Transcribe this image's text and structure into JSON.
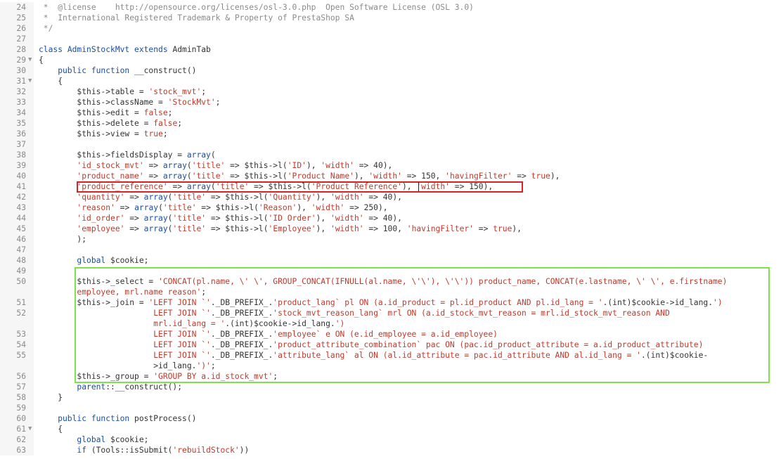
{
  "editor": {
    "lines": [
      {
        "n": "24",
        "fold": false,
        "tokens": [
          {
            "t": " *  @license    http://opensource.org/licenses/osl-3.0.php  Open Software License (OSL 3.0)",
            "k": "com"
          }
        ]
      },
      {
        "n": "25",
        "fold": false,
        "tokens": [
          {
            "t": " *  International Registered Trademark & Property of PrestaShop SA",
            "k": "com"
          }
        ]
      },
      {
        "n": "26",
        "fold": false,
        "tokens": [
          {
            "t": " */",
            "k": "com"
          }
        ]
      },
      {
        "n": "27",
        "fold": false,
        "tokens": []
      },
      {
        "n": "28",
        "fold": false,
        "tokens": [
          {
            "t": "class ",
            "k": "kw"
          },
          {
            "t": "AdminStockMvt ",
            "k": "kw"
          },
          {
            "t": "extends ",
            "k": "kw"
          },
          {
            "t": "AdminTab",
            "k": "def"
          }
        ]
      },
      {
        "n": "29",
        "fold": true,
        "tokens": [
          {
            "t": "{",
            "k": "def"
          }
        ]
      },
      {
        "n": "30",
        "fold": false,
        "tokens": [
          {
            "t": "    public function ",
            "k": "kw"
          },
          {
            "t": "__construct()",
            "k": "def"
          }
        ]
      },
      {
        "n": "31",
        "fold": true,
        "tokens": [
          {
            "t": "    {",
            "k": "def"
          }
        ]
      },
      {
        "n": "32",
        "fold": false,
        "tokens": [
          {
            "t": "        $this->table = ",
            "k": "def"
          },
          {
            "t": "'stock_mvt'",
            "k": "str"
          },
          {
            "t": ";",
            "k": "def"
          }
        ]
      },
      {
        "n": "33",
        "fold": false,
        "tokens": [
          {
            "t": "        $this->className = ",
            "k": "def"
          },
          {
            "t": "'StockMvt'",
            "k": "str"
          },
          {
            "t": ";",
            "k": "def"
          }
        ]
      },
      {
        "n": "34",
        "fold": false,
        "tokens": [
          {
            "t": "        $this->edit = ",
            "k": "def"
          },
          {
            "t": "false",
            "k": "str"
          },
          {
            "t": ";",
            "k": "def"
          }
        ]
      },
      {
        "n": "35",
        "fold": false,
        "tokens": [
          {
            "t": "        $this->delete = ",
            "k": "def"
          },
          {
            "t": "false",
            "k": "str"
          },
          {
            "t": ";",
            "k": "def"
          }
        ]
      },
      {
        "n": "36",
        "fold": false,
        "tokens": [
          {
            "t": "        $this->view = ",
            "k": "def"
          },
          {
            "t": "true",
            "k": "str"
          },
          {
            "t": ";",
            "k": "def"
          }
        ]
      },
      {
        "n": "37",
        "fold": false,
        "tokens": []
      },
      {
        "n": "38",
        "fold": false,
        "tokens": [
          {
            "t": "        $this->fieldsDisplay = ",
            "k": "def"
          },
          {
            "t": "array",
            "k": "kw"
          },
          {
            "t": "(",
            "k": "def"
          }
        ]
      },
      {
        "n": "39",
        "fold": false,
        "tokens": [
          {
            "t": "        ",
            "k": "def"
          },
          {
            "t": "'id_stock_mvt'",
            "k": "str"
          },
          {
            "t": " => ",
            "k": "def"
          },
          {
            "t": "array",
            "k": "kw"
          },
          {
            "t": "(",
            "k": "def"
          },
          {
            "t": "'title'",
            "k": "str"
          },
          {
            "t": " => $this->l(",
            "k": "def"
          },
          {
            "t": "'ID'",
            "k": "str"
          },
          {
            "t": "), ",
            "k": "def"
          },
          {
            "t": "'width'",
            "k": "str"
          },
          {
            "t": " => 40),",
            "k": "def"
          }
        ]
      },
      {
        "n": "40",
        "fold": false,
        "tokens": [
          {
            "t": "        ",
            "k": "def"
          },
          {
            "t": "'product_name'",
            "k": "str"
          },
          {
            "t": " => ",
            "k": "def"
          },
          {
            "t": "array",
            "k": "kw"
          },
          {
            "t": "(",
            "k": "def"
          },
          {
            "t": "'title'",
            "k": "str"
          },
          {
            "t": " => $this->l(",
            "k": "def"
          },
          {
            "t": "'Product Name'",
            "k": "str"
          },
          {
            "t": "), ",
            "k": "def"
          },
          {
            "t": "'width'",
            "k": "str"
          },
          {
            "t": " => 150, ",
            "k": "def"
          },
          {
            "t": "'havingFilter'",
            "k": "str"
          },
          {
            "t": " => ",
            "k": "def"
          },
          {
            "t": "true",
            "k": "str"
          },
          {
            "t": "),",
            "k": "def"
          }
        ]
      },
      {
        "n": "41",
        "fold": false,
        "tokens": [
          {
            "t": "        ",
            "k": "def"
          },
          {
            "t": "'product_reference'",
            "k": "str"
          },
          {
            "t": " => ",
            "k": "def"
          },
          {
            "t": "array",
            "k": "kw"
          },
          {
            "t": "(",
            "k": "def"
          },
          {
            "t": "'title'",
            "k": "str"
          },
          {
            "t": " => $this->l(",
            "k": "def"
          },
          {
            "t": "'Product Reference'",
            "k": "str"
          },
          {
            "t": "), ",
            "k": "def"
          },
          {
            "t": "'width'",
            "k": "str"
          },
          {
            "t": " => 150),",
            "k": "def"
          }
        ]
      },
      {
        "n": "42",
        "fold": false,
        "tokens": [
          {
            "t": "        ",
            "k": "def"
          },
          {
            "t": "'quantity'",
            "k": "str"
          },
          {
            "t": " => ",
            "k": "def"
          },
          {
            "t": "array",
            "k": "kw"
          },
          {
            "t": "(",
            "k": "def"
          },
          {
            "t": "'title'",
            "k": "str"
          },
          {
            "t": " => $this->l(",
            "k": "def"
          },
          {
            "t": "'Quantity'",
            "k": "str"
          },
          {
            "t": "), ",
            "k": "def"
          },
          {
            "t": "'width'",
            "k": "str"
          },
          {
            "t": " => 40),",
            "k": "def"
          }
        ]
      },
      {
        "n": "43",
        "fold": false,
        "tokens": [
          {
            "t": "        ",
            "k": "def"
          },
          {
            "t": "'reason'",
            "k": "str"
          },
          {
            "t": " => ",
            "k": "def"
          },
          {
            "t": "array",
            "k": "kw"
          },
          {
            "t": "(",
            "k": "def"
          },
          {
            "t": "'title'",
            "k": "str"
          },
          {
            "t": " => $this->l(",
            "k": "def"
          },
          {
            "t": "'Reason'",
            "k": "str"
          },
          {
            "t": "), ",
            "k": "def"
          },
          {
            "t": "'width'",
            "k": "str"
          },
          {
            "t": " => 250),",
            "k": "def"
          }
        ]
      },
      {
        "n": "44",
        "fold": false,
        "tokens": [
          {
            "t": "        ",
            "k": "def"
          },
          {
            "t": "'id_order'",
            "k": "str"
          },
          {
            "t": " => ",
            "k": "def"
          },
          {
            "t": "array",
            "k": "kw"
          },
          {
            "t": "(",
            "k": "def"
          },
          {
            "t": "'title'",
            "k": "str"
          },
          {
            "t": " => $this->l(",
            "k": "def"
          },
          {
            "t": "'ID Order'",
            "k": "str"
          },
          {
            "t": "), ",
            "k": "def"
          },
          {
            "t": "'width'",
            "k": "str"
          },
          {
            "t": " => 40),",
            "k": "def"
          }
        ]
      },
      {
        "n": "45",
        "fold": false,
        "tokens": [
          {
            "t": "        ",
            "k": "def"
          },
          {
            "t": "'employee'",
            "k": "str"
          },
          {
            "t": " => ",
            "k": "def"
          },
          {
            "t": "array",
            "k": "kw"
          },
          {
            "t": "(",
            "k": "def"
          },
          {
            "t": "'title'",
            "k": "str"
          },
          {
            "t": " => $this->l(",
            "k": "def"
          },
          {
            "t": "'Employee'",
            "k": "str"
          },
          {
            "t": "), ",
            "k": "def"
          },
          {
            "t": "'width'",
            "k": "str"
          },
          {
            "t": " => 100, ",
            "k": "def"
          },
          {
            "t": "'havingFilter'",
            "k": "str"
          },
          {
            "t": " => ",
            "k": "def"
          },
          {
            "t": "true",
            "k": "str"
          },
          {
            "t": "),",
            "k": "def"
          }
        ]
      },
      {
        "n": "46",
        "fold": false,
        "tokens": [
          {
            "t": "        );",
            "k": "def"
          }
        ]
      },
      {
        "n": "47",
        "fold": false,
        "tokens": []
      },
      {
        "n": "48",
        "fold": false,
        "tokens": [
          {
            "t": "        global ",
            "k": "kw"
          },
          {
            "t": "$cookie;",
            "k": "def"
          }
        ]
      },
      {
        "n": "49",
        "fold": false,
        "tokens": []
      },
      {
        "n": "50",
        "fold": false,
        "tokens": [
          {
            "t": "        $this->_select = ",
            "k": "def"
          },
          {
            "t": "'CONCAT(pl.name, \\' \\', GROUP_CONCAT(IFNULL(al.name, \\'\\'), \\'\\')) product_name, CONCAT(e.lastname, \\' \\', e.firstname)",
            "k": "str"
          }
        ]
      },
      {
        "n": "",
        "fold": false,
        "tokens": [
          {
            "t": "        employee, mrl.name reason'",
            "k": "str"
          },
          {
            "t": ";",
            "k": "def"
          }
        ]
      },
      {
        "n": "51",
        "fold": false,
        "tokens": [
          {
            "t": "        $this->_join = ",
            "k": "def"
          },
          {
            "t": "'LEFT JOIN `'",
            "k": "str"
          },
          {
            "t": "._DB_PREFIX_.",
            "k": "def"
          },
          {
            "t": "'product_lang` pl ON (a.id_product = pl.id_product AND pl.id_lang = '",
            "k": "str"
          },
          {
            "t": ".(int)$cookie->id_lang.",
            "k": "def"
          },
          {
            "t": "')",
            "k": "str"
          }
        ]
      },
      {
        "n": "52",
        "fold": false,
        "tokens": [
          {
            "t": "                        LEFT JOIN `'",
            "k": "str"
          },
          {
            "t": "._DB_PREFIX_.",
            "k": "def"
          },
          {
            "t": "'stock_mvt_reason_lang` mrl ON (a.id_stock_mvt_reason = mrl.id_stock_mvt_reason AND",
            "k": "str"
          }
        ]
      },
      {
        "n": "",
        "fold": false,
        "tokens": [
          {
            "t": "                        mrl.id_lang = '",
            "k": "str"
          },
          {
            "t": ".(int)$cookie->id_lang.",
            "k": "def"
          },
          {
            "t": "')",
            "k": "str"
          }
        ]
      },
      {
        "n": "53",
        "fold": false,
        "tokens": [
          {
            "t": "                        LEFT JOIN `'",
            "k": "str"
          },
          {
            "t": "._DB_PREFIX_.",
            "k": "def"
          },
          {
            "t": "'employee` e ON (e.id_employee = a.id_employee)",
            "k": "str"
          }
        ]
      },
      {
        "n": "54",
        "fold": false,
        "tokens": [
          {
            "t": "                        LEFT JOIN `'",
            "k": "str"
          },
          {
            "t": "._DB_PREFIX_.",
            "k": "def"
          },
          {
            "t": "'product_attribute_combination` pac ON (pac.id_product_attribute = a.id_product_attribute)",
            "k": "str"
          }
        ]
      },
      {
        "n": "55",
        "fold": false,
        "tokens": [
          {
            "t": "                        LEFT JOIN `'",
            "k": "str"
          },
          {
            "t": "._DB_PREFIX_.",
            "k": "def"
          },
          {
            "t": "'attribute_lang` al ON (al.id_attribute = pac.id_attribute AND al.id_lang = '",
            "k": "str"
          },
          {
            "t": ".(int)$cookie-",
            "k": "def"
          }
        ]
      },
      {
        "n": "",
        "fold": false,
        "tokens": [
          {
            "t": "                        >id_lang.",
            "k": "def"
          },
          {
            "t": "')'",
            "k": "str"
          },
          {
            "t": ";",
            "k": "def"
          }
        ]
      },
      {
        "n": "56",
        "fold": false,
        "tokens": [
          {
            "t": "        $this->_group = ",
            "k": "def"
          },
          {
            "t": "'GROUP BY a.id_stock_mvt'",
            "k": "str"
          },
          {
            "t": ";",
            "k": "def"
          }
        ]
      },
      {
        "n": "57",
        "fold": false,
        "tokens": [
          {
            "t": "        parent",
            "k": "kw"
          },
          {
            "t": "::__construct();",
            "k": "def"
          }
        ]
      },
      {
        "n": "58",
        "fold": false,
        "tokens": [
          {
            "t": "    }",
            "k": "def"
          }
        ]
      },
      {
        "n": "59",
        "fold": false,
        "tokens": []
      },
      {
        "n": "60",
        "fold": false,
        "tokens": [
          {
            "t": "    public function ",
            "k": "kw"
          },
          {
            "t": "postProcess()",
            "k": "def"
          }
        ]
      },
      {
        "n": "61",
        "fold": true,
        "tokens": [
          {
            "t": "    {",
            "k": "def"
          }
        ]
      },
      {
        "n": "62",
        "fold": false,
        "tokens": [
          {
            "t": "        global ",
            "k": "kw"
          },
          {
            "t": "$cookie;",
            "k": "def"
          }
        ]
      },
      {
        "n": "63",
        "fold": false,
        "tokens": [
          {
            "t": "        if ",
            "k": "kw"
          },
          {
            "t": "(Tools::isSubmit(",
            "k": "def"
          },
          {
            "t": "'rebuildStock'",
            "k": "str"
          },
          {
            "t": "))",
            "k": "def"
          }
        ]
      }
    ],
    "fold_glyph": "▼"
  },
  "highlights": {
    "red_color": "#d42424",
    "green_color": "#7ee24a"
  },
  "colors": {
    "keyword": "#1a4fa0",
    "string": "#c0392b",
    "comment": "#8a8a8a",
    "text": "#333333"
  }
}
